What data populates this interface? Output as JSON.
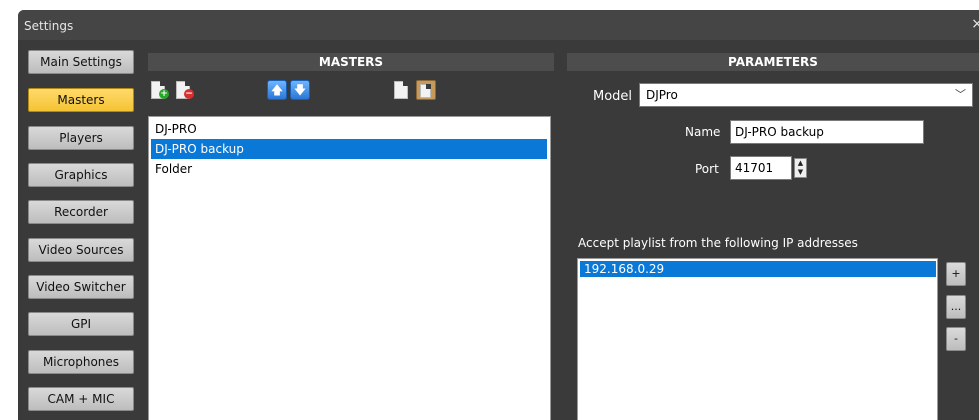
{
  "window": {
    "title": "Settings",
    "close_glyph": "×"
  },
  "sidebar": {
    "items": [
      {
        "label": "Main Settings",
        "active": false
      },
      {
        "label": "Masters",
        "active": true
      },
      {
        "label": "Players",
        "active": false
      },
      {
        "label": "Graphics",
        "active": false
      },
      {
        "label": "Recorder",
        "active": false
      },
      {
        "label": "Video Sources",
        "active": false
      },
      {
        "label": "Video Switcher",
        "active": false
      },
      {
        "label": "GPI",
        "active": false
      },
      {
        "label": "Microphones",
        "active": false
      },
      {
        "label": "CAM + MIC",
        "active": false
      }
    ]
  },
  "masters": {
    "header": "MASTERS",
    "toolbar": {
      "add_icon": "add-doc-icon",
      "remove_icon": "remove-doc-icon",
      "up_icon": "arrow-up-icon",
      "down_icon": "arrow-down-icon",
      "copy_icon": "copy-icon",
      "paste_icon": "paste-icon",
      "up_glyph": "🡅",
      "down_glyph": "🡇",
      "add_glyph": "+",
      "remove_glyph": "−"
    },
    "items": [
      {
        "label": "DJ-PRO",
        "selected": false
      },
      {
        "label": "DJ-PRO backup",
        "selected": true
      },
      {
        "label": "Folder",
        "selected": false
      }
    ]
  },
  "parameters": {
    "header": "PARAMETERS",
    "model_label": "Model",
    "model_value": "DJPro",
    "name_label": "Name",
    "name_value": "DJ-PRO backup",
    "port_label": "Port",
    "port_value": "41701",
    "ip_caption": "Accept playlist from the following IP addresses",
    "ip_items": [
      "192.168.0.29"
    ],
    "ip_buttons": {
      "add": "+",
      "edit": "...",
      "remove": "-"
    }
  },
  "colors": {
    "accent_selected": "#0a78d7",
    "active_tab": "#f5c433",
    "window_bg": "#3a3a3a"
  }
}
